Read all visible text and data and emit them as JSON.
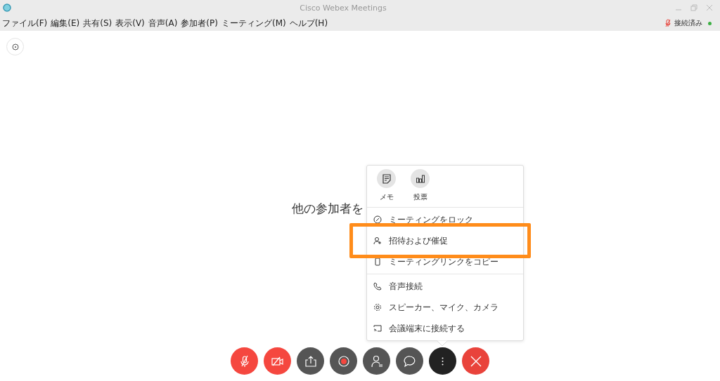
{
  "window": {
    "title": "Cisco Webex Meetings"
  },
  "menu_bar": [
    "ファイル(F)",
    "編集(E)",
    "共有(S)",
    "表示(V)",
    "音声(A)",
    "参加者(P)",
    "ミーティング(M)",
    "ヘルプ(H)"
  ],
  "status": {
    "label": "接続済み",
    "connected": true
  },
  "stage": {
    "message": "他の参加者を"
  },
  "more_menu": {
    "quick_actions": [
      {
        "kind": "memo",
        "label": "メモ"
      },
      {
        "kind": "poll",
        "label": "投票"
      }
    ],
    "sections": [
      [
        {
          "kind": "lock",
          "label": "ミーティングをロック"
        },
        {
          "kind": "invite",
          "label": "招待および催促"
        },
        {
          "kind": "copy",
          "label": "ミーティングリンクをコピー"
        }
      ],
      [
        {
          "kind": "phone",
          "label": "音声接続"
        },
        {
          "kind": "gear",
          "label": "スピーカー、マイク、カメラ"
        },
        {
          "kind": "cast",
          "label": "会議端末に接続する"
        }
      ]
    ]
  },
  "toolbar": [
    {
      "kind": "mute"
    },
    {
      "kind": "video"
    },
    {
      "kind": "share"
    },
    {
      "kind": "record"
    },
    {
      "kind": "participants"
    },
    {
      "kind": "chat"
    },
    {
      "kind": "more"
    },
    {
      "kind": "leave"
    }
  ]
}
